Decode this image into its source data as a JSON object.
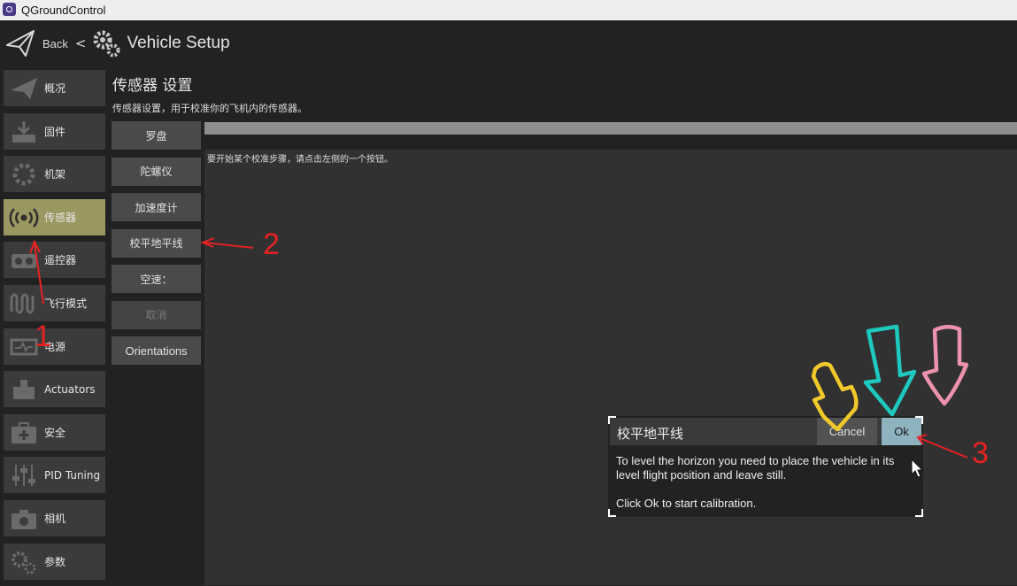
{
  "window": {
    "title": "QGroundControl"
  },
  "header": {
    "back_label": "Back",
    "separator": "<",
    "page_label": "Vehicle Setup"
  },
  "sidebar": {
    "items": [
      {
        "label": "概况",
        "icon": "paper-plane-icon",
        "active": false
      },
      {
        "label": "固件",
        "icon": "firmware-download-icon",
        "active": false
      },
      {
        "label": "机架",
        "icon": "airframe-icon",
        "active": false
      },
      {
        "label": "传感器",
        "icon": "sensor-waves-icon",
        "active": true
      },
      {
        "label": "遥控器",
        "icon": "radio-controller-icon",
        "active": false
      },
      {
        "label": "飞行模式",
        "icon": "flight-modes-wave-icon",
        "active": false
      },
      {
        "label": "电源",
        "icon": "power-monitor-icon",
        "active": false
      },
      {
        "label": "Actuators",
        "icon": "actuators-icon",
        "active": false
      },
      {
        "label": "安全",
        "icon": "first-aid-kit-icon",
        "active": false
      },
      {
        "label": "PID Tuning",
        "icon": "sliders-icon",
        "active": false
      },
      {
        "label": "相机",
        "icon": "camera-icon",
        "active": false
      },
      {
        "label": "参数",
        "icon": "parameters-gears-icon",
        "active": false
      }
    ]
  },
  "sensors": {
    "title": "传感器 设置",
    "description": "传感器设置，用于校准你的飞机内的传感器。",
    "buttons": [
      {
        "label": "罗盘",
        "enabled": true
      },
      {
        "label": "陀螺仪",
        "enabled": true
      },
      {
        "label": "加速度计",
        "enabled": true
      },
      {
        "label": "校平地平线",
        "enabled": true
      },
      {
        "label": "空速：",
        "enabled": true
      },
      {
        "label": "取消",
        "enabled": false
      },
      {
        "label": "Orientations",
        "enabled": true
      }
    ],
    "progress": 0,
    "instruction": "要开始某个校准步骤，请点击左侧的一个按钮。"
  },
  "dialog": {
    "title": "校平地平线",
    "cancel_label": "Cancel",
    "ok_label": "Ok",
    "body_line1": "To level the horizon you need to place the vehicle in its level flight position and leave still.",
    "body_line2": "Click Ok to start calibration."
  },
  "annotations": {
    "step1": "1",
    "step2": "2",
    "step3": "3",
    "marker_colors": [
      "#e52222",
      "#f2c92b",
      "#1ec9c0",
      "#ec92ac"
    ]
  }
}
